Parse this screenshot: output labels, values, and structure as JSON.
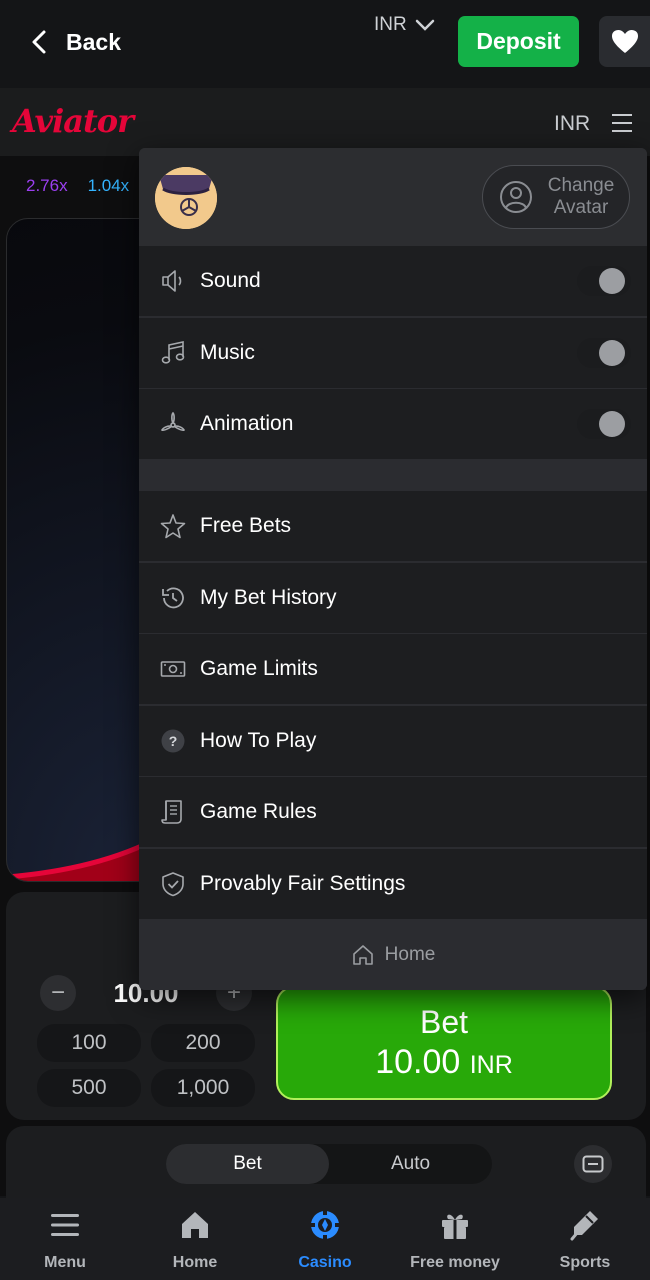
{
  "topbar": {
    "back_label": "Back",
    "currency": "INR",
    "deposit_label": "Deposit"
  },
  "game": {
    "logo": "Aviator",
    "currency": "INR",
    "multipliers": [
      "2.76x",
      "1.04x"
    ]
  },
  "menu": {
    "change_avatar": "Change Avatar",
    "toggles": [
      {
        "label": "Sound",
        "icon": "speaker-icon",
        "on": false
      },
      {
        "label": "Music",
        "icon": "music-icon",
        "on": false
      },
      {
        "label": "Animation",
        "icon": "propeller-icon",
        "on": false
      }
    ],
    "items": [
      {
        "label": "Free Bets",
        "icon": "star-icon"
      },
      {
        "label": "My Bet History",
        "icon": "history-icon"
      },
      {
        "label": "Game Limits",
        "icon": "banknote-icon"
      },
      {
        "label": "How To Play",
        "icon": "question-icon"
      },
      {
        "label": "Game Rules",
        "icon": "scroll-icon"
      },
      {
        "label": "Provably Fair Settings",
        "icon": "shield-check-icon"
      }
    ],
    "home_label": "Home"
  },
  "bet": {
    "stake": "10.00",
    "quick_amounts": [
      "100",
      "200",
      "500",
      "1,000"
    ],
    "button_title": "Bet",
    "button_amount": "10.00",
    "button_currency": "INR",
    "tabs": [
      "Bet",
      "Auto"
    ]
  },
  "nav": {
    "items": [
      "Menu",
      "Home",
      "Casino",
      "Free money",
      "Sports"
    ],
    "active": "Casino"
  },
  "colors": {
    "accent_green": "#14b148",
    "brand_red": "#e50539",
    "nav_active": "#2b8cff"
  }
}
